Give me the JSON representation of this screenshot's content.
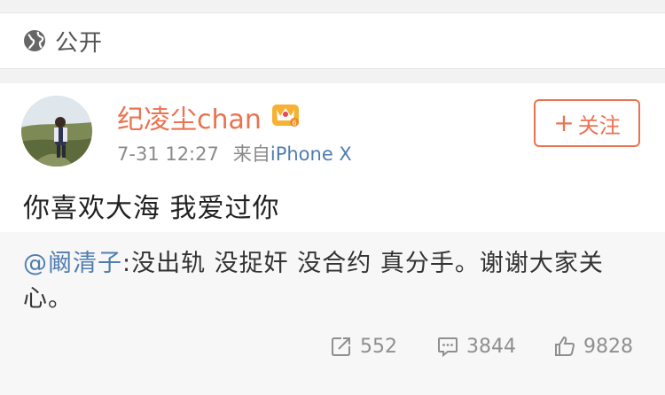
{
  "visibility": {
    "icon": "globe-icon",
    "label": "公开"
  },
  "post": {
    "username": "纪凌尘chan",
    "badge_icon": "vip-crown-icon",
    "time": "7-31 12:27",
    "source_prefix": "来自",
    "source_device": "iPhone X",
    "follow_label": "关注",
    "follow_icon": "plus-icon",
    "text": "你喜欢大海 我爱过你"
  },
  "repost": {
    "mention": "@阚清子",
    "text": ":没出轨 没捉奸 没合约 真分手。谢谢大家关心。"
  },
  "actions": {
    "repost_count": "552",
    "comment_count": "3844",
    "like_count": "9828"
  },
  "colors": {
    "accent": "#eb7350",
    "link": "#507daf"
  }
}
